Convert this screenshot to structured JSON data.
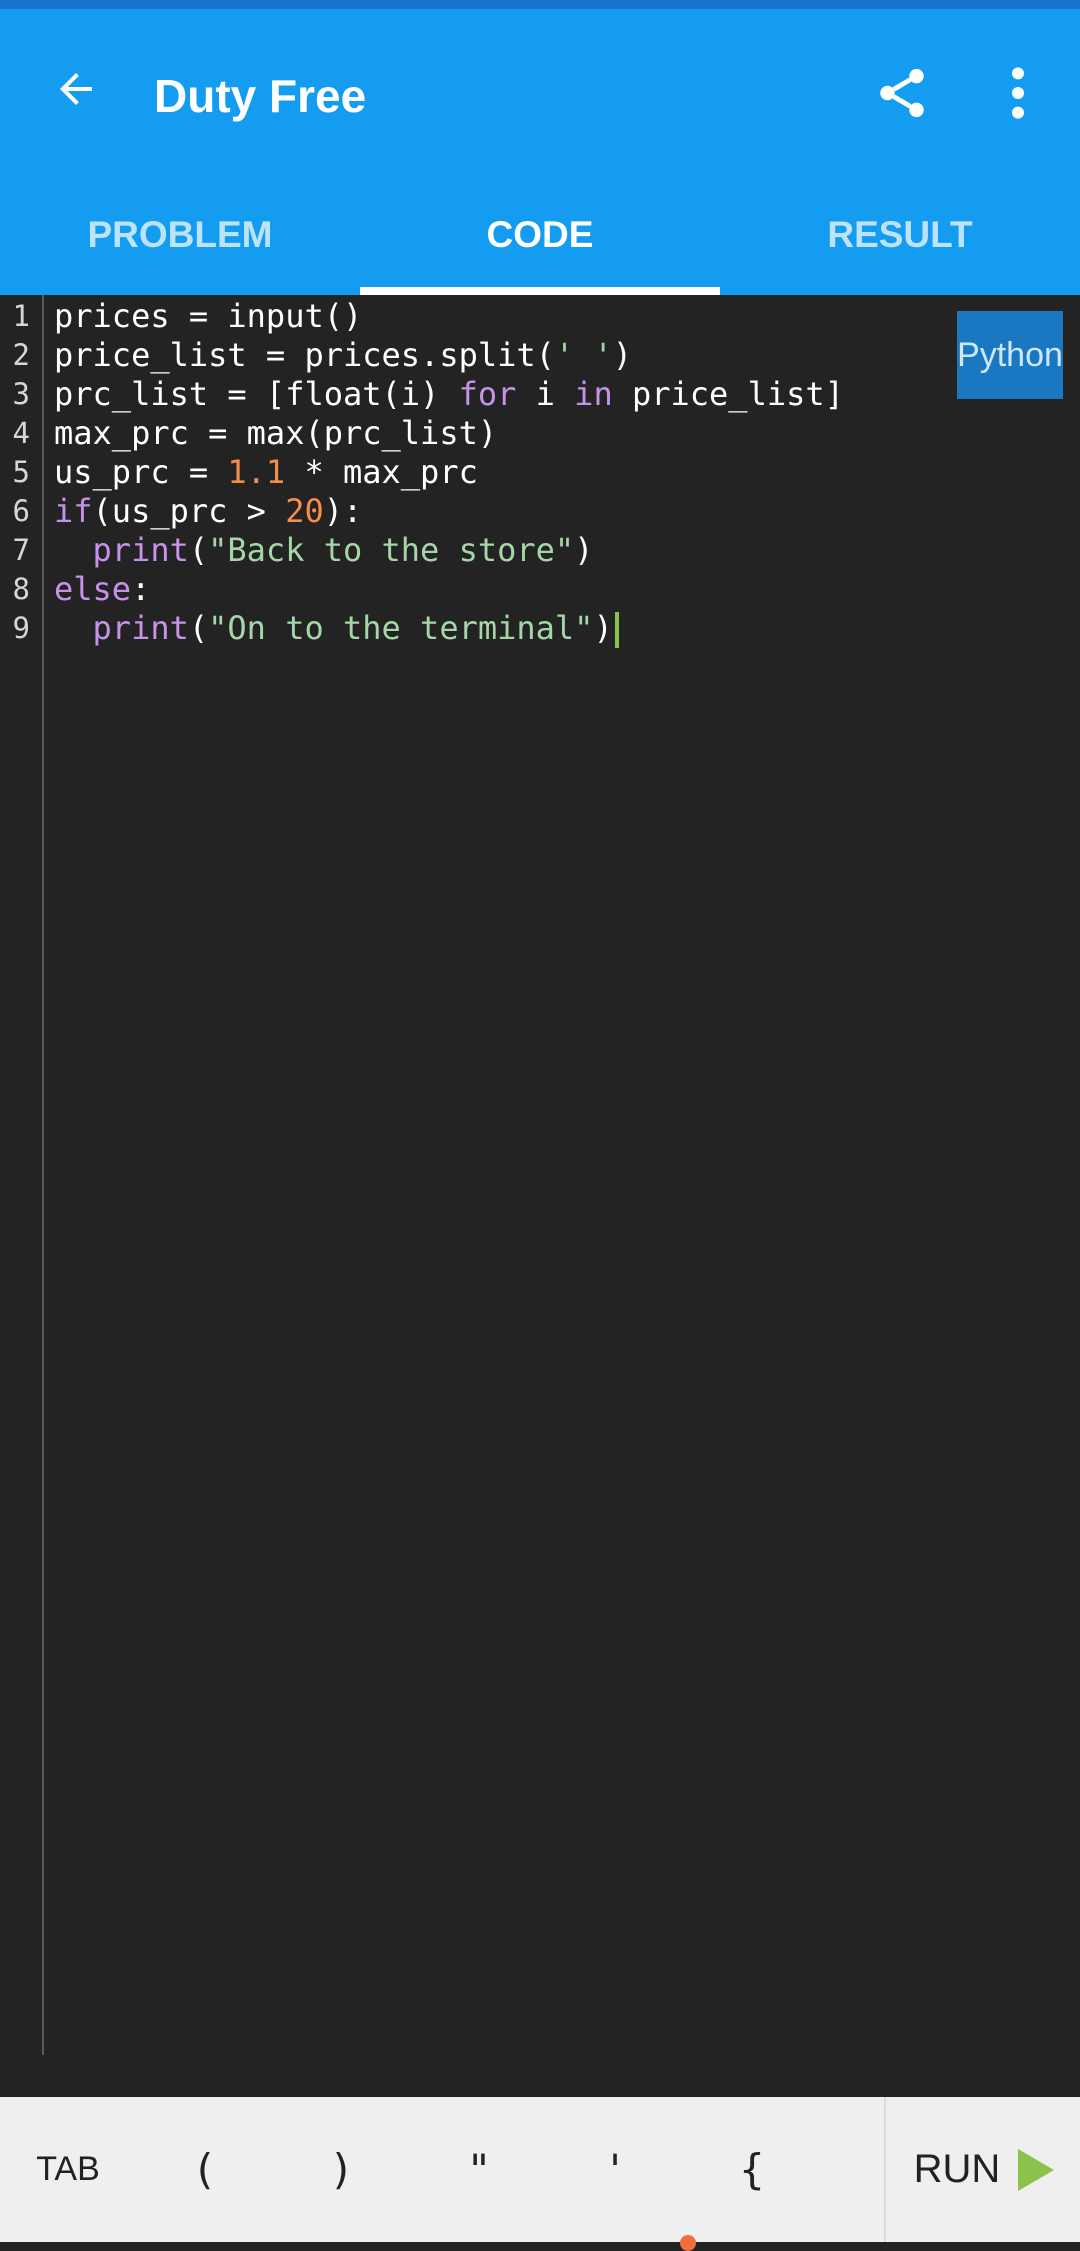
{
  "app": {
    "title": "Duty Free",
    "tabs": [
      {
        "label": "PROBLEM",
        "active": false
      },
      {
        "label": "CODE",
        "active": true
      },
      {
        "label": "RESULT",
        "active": false
      }
    ],
    "icons": [
      "arrow-back-icon",
      "share-icon",
      "more-vert-icon"
    ]
  },
  "editor": {
    "language": "Python",
    "line_numbers": [
      "1",
      "2",
      "3",
      "4",
      "5",
      "6",
      "7",
      "8",
      "9"
    ],
    "lines": [
      "prices = input()",
      "price_list = prices.split(' ')",
      "prc_list = [float(i) for i in price_list]",
      "max_prc = max(prc_list)",
      "us_prc = 1.1 * max_prc",
      "if(us_prc > 20):",
      "  print(\"Back to the store\")",
      "else:",
      "  print(\"On to the terminal\")"
    ],
    "cursor_line": 9
  },
  "keyboard_bar": {
    "keys": [
      "TAB",
      "(",
      ")",
      "\"",
      "'",
      "{"
    ],
    "run_label": "RUN"
  },
  "colors": {
    "app_bar": "#149cf0",
    "status_bar": "#1775d2",
    "editor_bg": "#232323",
    "keyword": "#c792ea",
    "number": "#f78c4b",
    "string": "#a5d6a7",
    "run_icon": "#8bc34a"
  }
}
